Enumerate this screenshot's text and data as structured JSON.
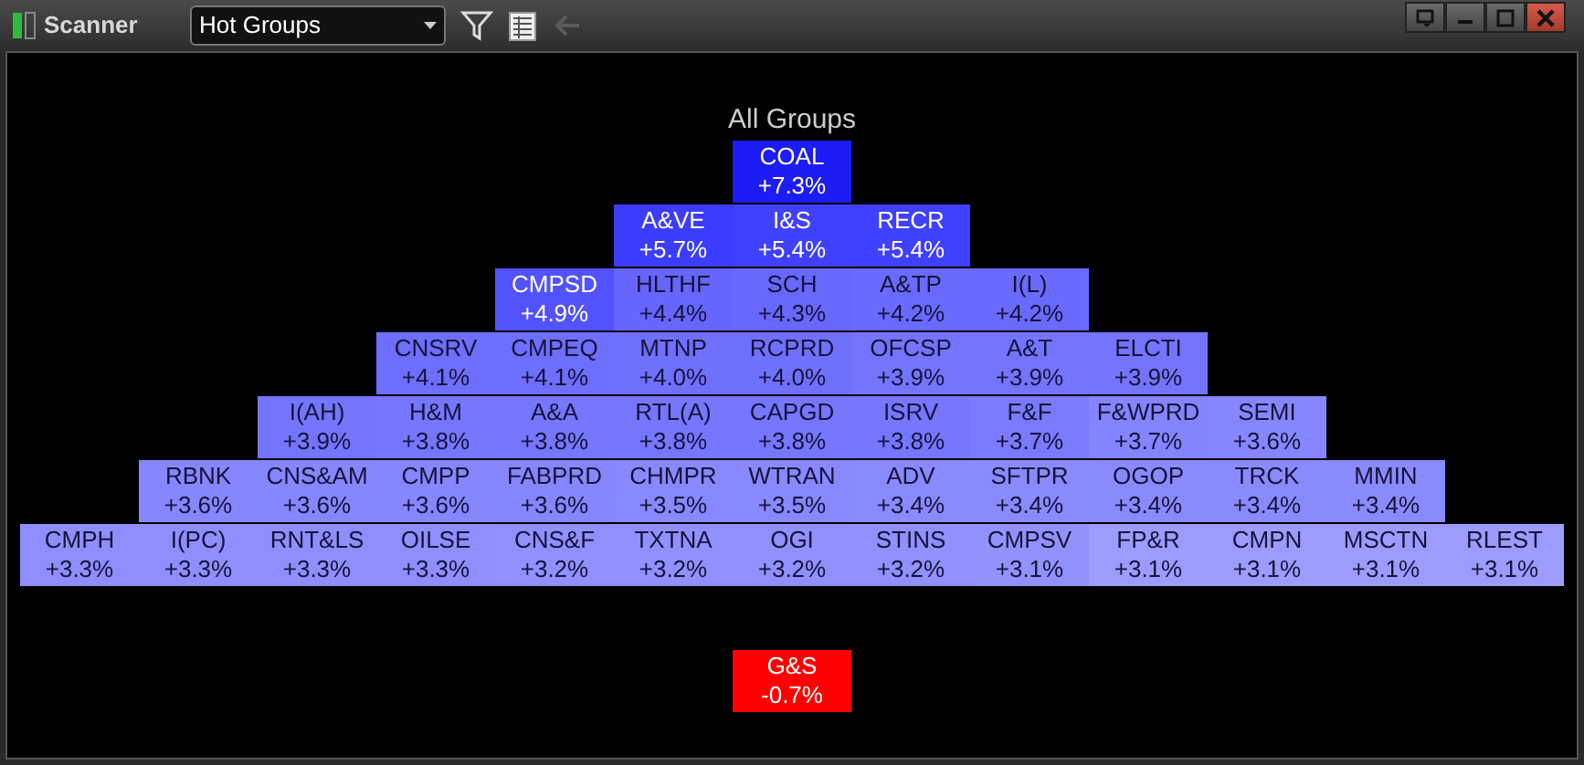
{
  "window": {
    "title": "Scanner",
    "view_select": {
      "value": "Hot Groups"
    }
  },
  "heading": "All Groups",
  "rows": [
    {
      "cells": [
        {
          "symbol": "COAL",
          "change": "+7.3%",
          "color": "#1c1cf6"
        }
      ]
    },
    {
      "cells": [
        {
          "symbol": "A&VE",
          "change": "+5.7%",
          "color": "#3c3cff"
        },
        {
          "symbol": "I&S",
          "change": "+5.4%",
          "color": "#4040ff"
        },
        {
          "symbol": "RECR",
          "change": "+5.4%",
          "color": "#4040ff"
        }
      ]
    },
    {
      "cells": [
        {
          "symbol": "CMPSD",
          "change": "+4.9%",
          "color": "#5252ff"
        },
        {
          "symbol": "HLTHF",
          "change": "+4.4%",
          "color": "#6666ff"
        },
        {
          "symbol": "SCH",
          "change": "+4.3%",
          "color": "#6868ff"
        },
        {
          "symbol": "A&TP",
          "change": "+4.2%",
          "color": "#6a6aff"
        },
        {
          "symbol": "I(L)",
          "change": "+4.2%",
          "color": "#6a6aff"
        }
      ]
    },
    {
      "cells": [
        {
          "symbol": "CNSRV",
          "change": "+4.1%",
          "color": "#6e6eff"
        },
        {
          "symbol": "CMPEQ",
          "change": "+4.1%",
          "color": "#6e6eff"
        },
        {
          "symbol": "MTNP",
          "change": "+4.0%",
          "color": "#7070ff"
        },
        {
          "symbol": "RCPRD",
          "change": "+4.0%",
          "color": "#7070ff"
        },
        {
          "symbol": "OFCSP",
          "change": "+3.9%",
          "color": "#7474ff"
        },
        {
          "symbol": "A&T",
          "change": "+3.9%",
          "color": "#7474ff"
        },
        {
          "symbol": "ELCTI",
          "change": "+3.9%",
          "color": "#7474ff"
        }
      ]
    },
    {
      "cells": [
        {
          "symbol": "I(AH)",
          "change": "+3.9%",
          "color": "#7474ff"
        },
        {
          "symbol": "H&M",
          "change": "+3.8%",
          "color": "#7676ff"
        },
        {
          "symbol": "A&A",
          "change": "+3.8%",
          "color": "#7676ff"
        },
        {
          "symbol": "RTL(A)",
          "change": "+3.8%",
          "color": "#7676ff"
        },
        {
          "symbol": "CAPGD",
          "change": "+3.8%",
          "color": "#7676ff"
        },
        {
          "symbol": "ISRV",
          "change": "+3.8%",
          "color": "#7676ff"
        },
        {
          "symbol": "F&F",
          "change": "+3.7%",
          "color": "#7a7aff"
        },
        {
          "symbol": "F&WPRD",
          "change": "+3.7%",
          "color": "#8484ff"
        },
        {
          "symbol": "SEMI",
          "change": "+3.6%",
          "color": "#8686ff"
        }
      ]
    },
    {
      "cells": [
        {
          "symbol": "RBNK",
          "change": "+3.6%",
          "color": "#8686ff"
        },
        {
          "symbol": "CNS&AM",
          "change": "+3.6%",
          "color": "#8686ff"
        },
        {
          "symbol": "CMPP",
          "change": "+3.6%",
          "color": "#8686ff"
        },
        {
          "symbol": "FABPRD",
          "change": "+3.6%",
          "color": "#8686ff"
        },
        {
          "symbol": "CHMPR",
          "change": "+3.5%",
          "color": "#8888ff"
        },
        {
          "symbol": "WTRAN",
          "change": "+3.5%",
          "color": "#8888ff"
        },
        {
          "symbol": "ADV",
          "change": "+3.4%",
          "color": "#8a8aff"
        },
        {
          "symbol": "SFTPR",
          "change": "+3.4%",
          "color": "#8a8aff"
        },
        {
          "symbol": "OGOP",
          "change": "+3.4%",
          "color": "#8a8aff"
        },
        {
          "symbol": "TRCK",
          "change": "+3.4%",
          "color": "#8a8aff"
        },
        {
          "symbol": "MMIN",
          "change": "+3.4%",
          "color": "#8a8aff"
        }
      ]
    },
    {
      "cells": [
        {
          "symbol": "CMPH",
          "change": "+3.3%",
          "color": "#8e8eff"
        },
        {
          "symbol": "I(PC)",
          "change": "+3.3%",
          "color": "#8e8eff"
        },
        {
          "symbol": "RNT&LS",
          "change": "+3.3%",
          "color": "#8e8eff"
        },
        {
          "symbol": "OILSE",
          "change": "+3.3%",
          "color": "#8e8eff"
        },
        {
          "symbol": "CNS&F",
          "change": "+3.2%",
          "color": "#9090ff"
        },
        {
          "symbol": "TXTNA",
          "change": "+3.2%",
          "color": "#9090ff"
        },
        {
          "symbol": "OGI",
          "change": "+3.2%",
          "color": "#9090ff"
        },
        {
          "symbol": "STINS",
          "change": "+3.2%",
          "color": "#9090ff"
        },
        {
          "symbol": "CMPSV",
          "change": "+3.1%",
          "color": "#9292ff"
        },
        {
          "symbol": "FP&R",
          "change": "+3.1%",
          "color": "#9c9cff"
        },
        {
          "symbol": "CMPN",
          "change": "+3.1%",
          "color": "#9c9cff"
        },
        {
          "symbol": "MSCTN",
          "change": "+3.1%",
          "color": "#9c9cff"
        },
        {
          "symbol": "RLEST",
          "change": "+3.1%",
          "color": "#9c9cff"
        }
      ]
    }
  ],
  "losers": [
    {
      "cells": [
        {
          "symbol": "G&S",
          "change": "-0.7%",
          "color": "#ff0000"
        }
      ]
    }
  ]
}
